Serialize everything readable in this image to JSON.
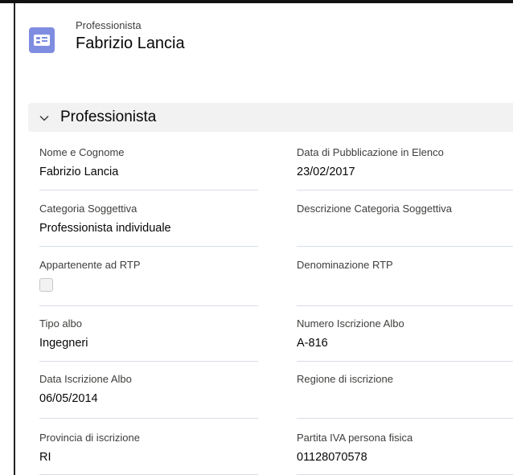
{
  "header": {
    "object_name": "Professionista",
    "record_name": "Fabrizio Lancia",
    "icon": "contact-card-icon",
    "icon_color": "#7f8de1"
  },
  "section": {
    "title": "Professionista",
    "expanded": true
  },
  "fields": {
    "nome_cognome": {
      "label": "Nome e Cognome",
      "value": "Fabrizio Lancia"
    },
    "data_pubblicazione": {
      "label": "Data di Pubblicazione in Elenco",
      "value": "23/02/2017"
    },
    "categoria_soggettiva": {
      "label": "Categoria Soggettiva",
      "value": "Professionista individuale"
    },
    "descrizione_categoria": {
      "label": "Descrizione Categoria Soggettiva",
      "value": ""
    },
    "appartenente_rtp": {
      "label": "Appartenente ad RTP",
      "checked": false
    },
    "denominazione_rtp": {
      "label": "Denominazione RTP",
      "value": ""
    },
    "tipo_albo": {
      "label": "Tipo albo",
      "value": "Ingegneri"
    },
    "numero_iscrizione": {
      "label": "Numero Iscrizione Albo",
      "value": "A-816"
    },
    "data_iscrizione": {
      "label": "Data Iscrizione Albo",
      "value": "06/05/2014"
    },
    "regione_iscrizione": {
      "label": "Regione di iscrizione",
      "value": ""
    },
    "provincia_iscrizione": {
      "label": "Provincia di iscrizione",
      "value": "RI"
    },
    "partita_iva": {
      "label": "Partita IVA persona fisica",
      "value": "01128070578"
    }
  }
}
